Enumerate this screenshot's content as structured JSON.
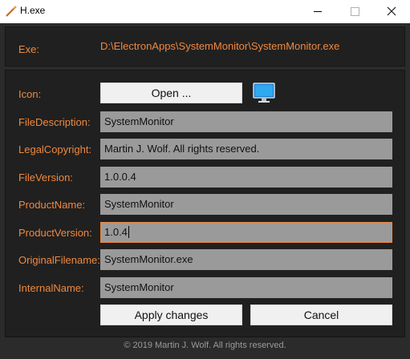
{
  "window": {
    "title": "H.exe"
  },
  "exe": {
    "label": "Exe:",
    "value": "D:\\ElectronApps\\SystemMonitor\\SystemMonitor.exe"
  },
  "icon_row": {
    "label": "Icon:",
    "open_button": "Open ...",
    "preview_icon": "monitor-icon"
  },
  "fields": {
    "file_description": {
      "label": "FileDescription:",
      "value": "SystemMonitor"
    },
    "legal_copyright": {
      "label": "LegalCopyright:",
      "value": "Martin J. Wolf. All rights reserved."
    },
    "file_version": {
      "label": "FileVersion:",
      "value": "1.0.0.4"
    },
    "product_name": {
      "label": "ProductName:",
      "value": "SystemMonitor"
    },
    "product_version": {
      "label": "ProductVersion:",
      "value": "1.0.4"
    },
    "original_filename": {
      "label": "OriginalFilename:",
      "value": "SystemMonitor.exe"
    },
    "internal_name": {
      "label": "InternalName:",
      "value": "SystemMonitor"
    }
  },
  "actions": {
    "apply": "Apply changes",
    "cancel": "Cancel"
  },
  "footer": {
    "text": "© 2019 Martin J. Wolf. All rights reserved."
  },
  "colors": {
    "accent": "#f0883e",
    "background": "#2b2b2b",
    "panel": "#202020",
    "field": "#9a9a9a"
  }
}
